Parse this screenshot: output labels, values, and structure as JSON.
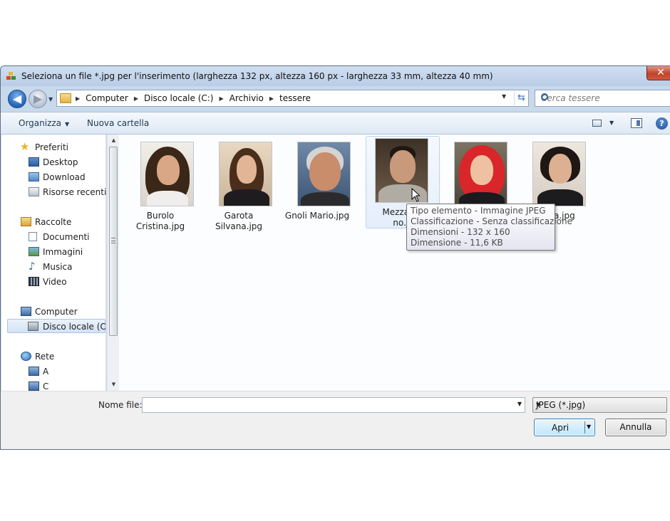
{
  "window": {
    "title": "Seleziona un file *.jpg per l'inserimento (larghezza 132 px, altezza 160 px - larghezza 33 mm, altezza 40 mm)",
    "close_label": "✕"
  },
  "nav": {
    "back_glyph": "◀",
    "forward_glyph": "▶",
    "breadcrumbs": [
      "Computer",
      "Disco locale (C:)",
      "Archivio",
      "tessere"
    ],
    "search_placeholder": "Cerca tessere"
  },
  "toolbar": {
    "organize_label": "Organizza",
    "new_folder_label": "Nuova cartella",
    "help_label": "?"
  },
  "sidebar": {
    "favorites": {
      "label": "Preferiti",
      "items": [
        "Desktop",
        "Download",
        "Risorse recenti"
      ]
    },
    "libraries": {
      "label": "Raccolte",
      "items": [
        "Documenti",
        "Immagini",
        "Musica",
        "Video"
      ]
    },
    "computer": {
      "label": "Computer",
      "items": [
        "Disco locale (C:)"
      ]
    },
    "network": {
      "label": "Rete",
      "items": [
        "A",
        "C"
      ]
    },
    "selected_item": "Disco locale (C:)"
  },
  "files": [
    {
      "line1": "Burolo",
      "line2": "Cristina.jpg"
    },
    {
      "line1": "Garota",
      "line2": "Silvana.jpg"
    },
    {
      "line1": "Gnoli Mario.jpg",
      "line2": ""
    },
    {
      "line1": "Mezzacap",
      "line2": "no.jp"
    },
    {
      "line1": "",
      "line2": ""
    },
    {
      "line1": "a Ilaria.jpg",
      "line2": ""
    }
  ],
  "tooltip": {
    "lines": [
      "Tipo elemento - Immagine JPEG",
      "Classificazione - Senza classificazione",
      "Dimensioni - 132 x 160",
      "Dimensione - 11,6 KB"
    ]
  },
  "bottom": {
    "filename_label": "Nome file:",
    "filename_value": "",
    "filetype_value": "JPEG (*.jpg)",
    "open_label": "Apri",
    "cancel_label": "Annulla"
  }
}
